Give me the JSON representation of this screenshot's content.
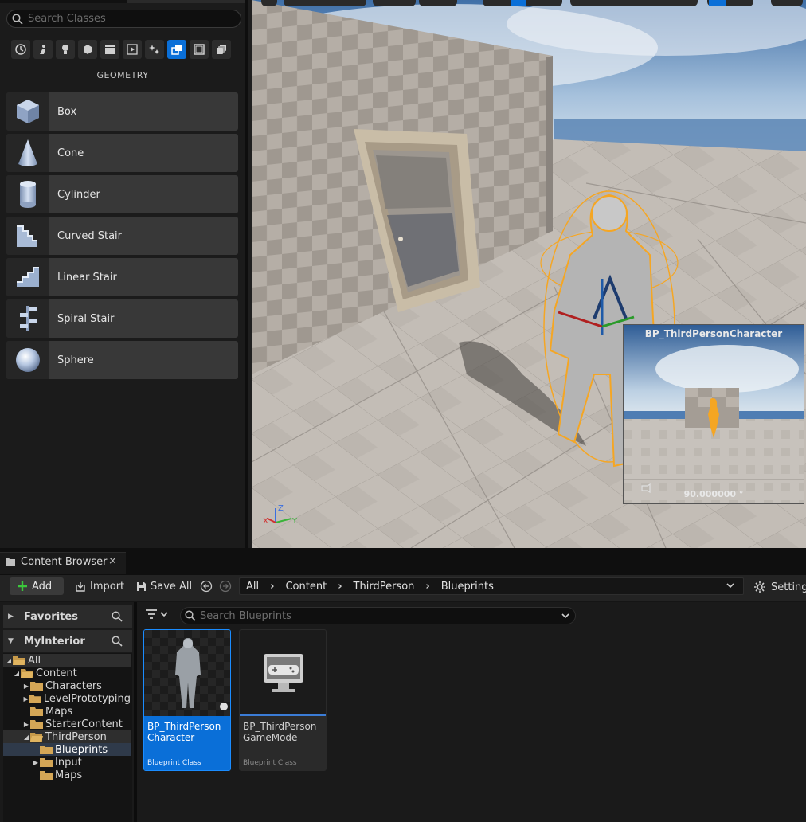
{
  "place_actors": {
    "search_placeholder": "Search Classes",
    "category": "GEOMETRY",
    "items": [
      {
        "label": "Box",
        "icon": "box-icon"
      },
      {
        "label": "Cone",
        "icon": "cone-icon"
      },
      {
        "label": "Cylinder",
        "icon": "cylinder-icon"
      },
      {
        "label": "Curved Stair",
        "icon": "curved-stair-icon"
      },
      {
        "label": "Linear Stair",
        "icon": "linear-stair-icon"
      },
      {
        "label": "Spiral Stair",
        "icon": "spiral-stair-icon"
      },
      {
        "label": "Sphere",
        "icon": "sphere-icon"
      }
    ]
  },
  "viewport": {
    "camera_preview": {
      "title": "BP_ThirdPersonCharacter",
      "fov": "90.000000 °"
    },
    "axis": {
      "x": "X",
      "y": "Y",
      "z": "Z"
    }
  },
  "content_browser": {
    "tab_label": "Content Browser",
    "close": "×",
    "toolbar": {
      "add": "Add",
      "import": "Import",
      "save_all": "Save All",
      "settings": "Settings"
    },
    "breadcrumb": [
      "All",
      "Content",
      "ThirdPerson",
      "Blueprints"
    ],
    "sources": {
      "favorites": "Favorites",
      "project": "MyInterior",
      "tree": [
        {
          "label": "All",
          "depth": 0,
          "arrow": "down"
        },
        {
          "label": "Content",
          "depth": 1,
          "arrow": "down"
        },
        {
          "label": "Characters",
          "depth": 2,
          "arrow": "right"
        },
        {
          "label": "LevelPrototyping",
          "depth": 2,
          "arrow": "right"
        },
        {
          "label": "Maps",
          "depth": 2,
          "arrow": ""
        },
        {
          "label": "StarterContent",
          "depth": 2,
          "arrow": "right"
        },
        {
          "label": "ThirdPerson",
          "depth": 2,
          "arrow": "down"
        },
        {
          "label": "Blueprints",
          "depth": 3,
          "arrow": ""
        },
        {
          "label": "Input",
          "depth": 3,
          "arrow": "right"
        },
        {
          "label": "Maps",
          "depth": 3,
          "arrow": ""
        }
      ]
    },
    "search_placeholder": "Search Blueprints",
    "assets": [
      {
        "name_line1": "BP_ThirdPerson",
        "name_line2": "Character",
        "type": "Blueprint Class",
        "selected": true
      },
      {
        "name_line1": "BP_ThirdPerson",
        "name_line2": "GameMode",
        "type": "Blueprint Class",
        "selected": false
      }
    ]
  },
  "colors": {
    "accent": "#0a6fd8",
    "selection_outline": "#f5a623"
  }
}
